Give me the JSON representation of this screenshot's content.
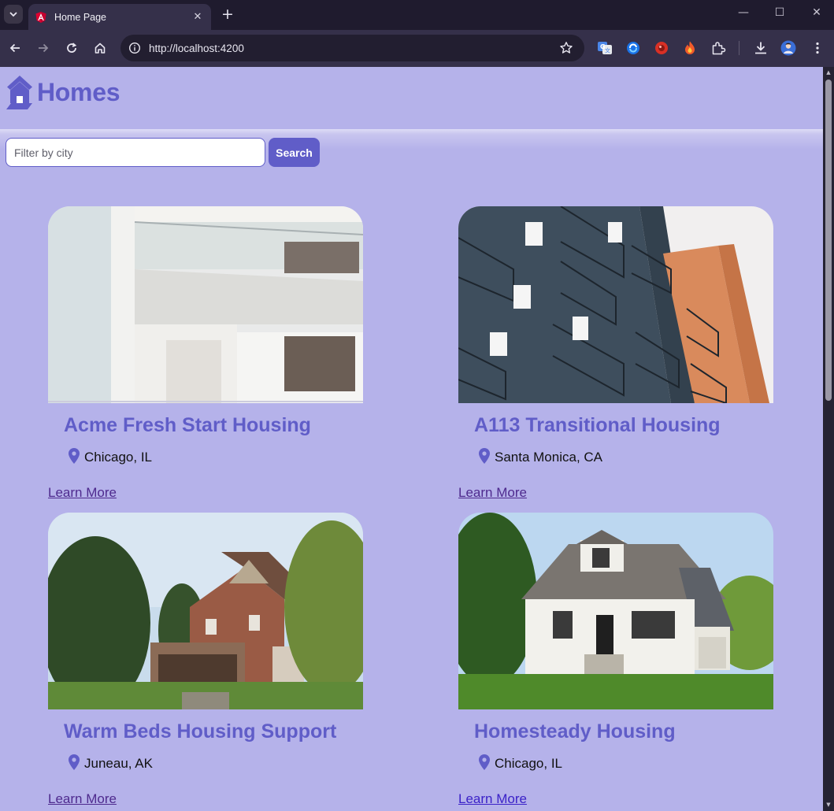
{
  "browser": {
    "tab_title": "Home Page",
    "url": "http://localhost:4200",
    "new_tab_label": "+",
    "colors": {
      "frame": "#1f1b2e",
      "toolbar": "#35304a",
      "omnibox": "#221e30"
    }
  },
  "page": {
    "brand": "Homes",
    "search": {
      "placeholder": "Filter by city",
      "button_label": "Search"
    },
    "colors": {
      "background": "#b5b2ea",
      "accent": "#605dc8",
      "link": "#4e2a8e"
    },
    "listings": [
      {
        "title": "Acme Fresh Start Housing",
        "location": "Chicago, IL",
        "link_label": "Learn More",
        "photo": "modern white apartment building with glass balconies"
      },
      {
        "title": "A113 Transitional Housing",
        "location": "Santa Monica, CA",
        "link_label": "Learn More",
        "photo": "blue apartment building with black balconies"
      },
      {
        "title": "Warm Beds Housing Support",
        "location": "Juneau, AK",
        "link_label": "Learn More",
        "photo": "Victorian brick house surrounded by trees"
      },
      {
        "title": "Homesteady Housing",
        "location": "Chicago, IL",
        "link_label": "Learn More",
        "photo": "white cottage house with lawn"
      }
    ]
  }
}
